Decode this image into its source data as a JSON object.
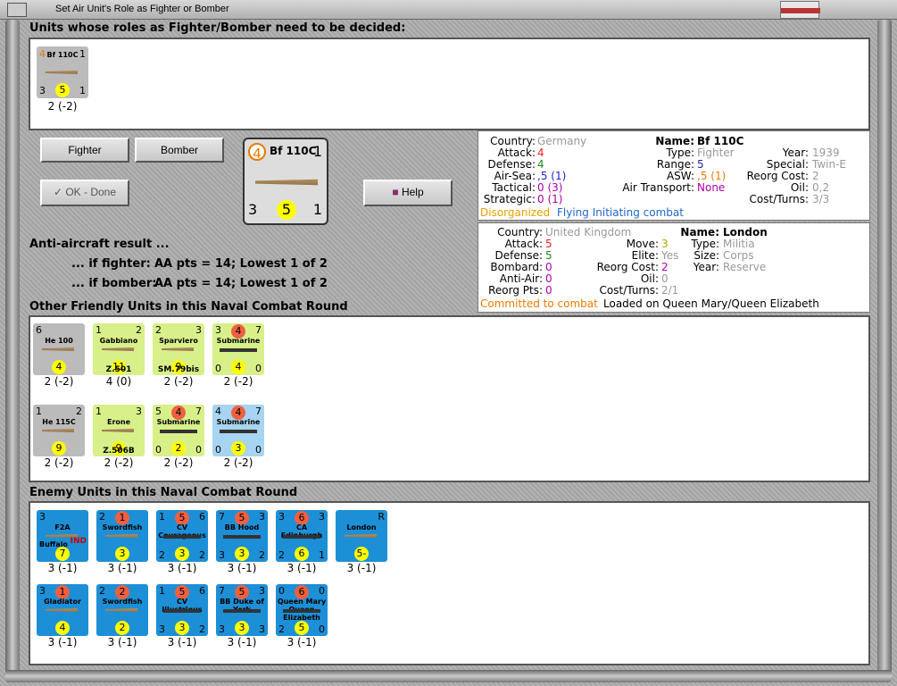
{
  "window": {
    "title": "Set Air Unit's Role as Fighter or Bomber"
  },
  "headers": {
    "undecided": "Units whose roles as Fighter/Bomber need to be decided:",
    "friendly": "Other Friendly Units in this Naval Combat Round",
    "enemy": "Enemy Units in this Naval Combat Round"
  },
  "buttons": {
    "fighter": "Fighter",
    "bomber": "Bomber",
    "ok": "OK - Done",
    "help": "Help"
  },
  "aa": {
    "title": "Anti-aircraft result ...",
    "fighter_lbl": "... if fighter:",
    "fighter_val": "AA pts = 14; Lowest 1 of 2",
    "bomber_lbl": "... if bomber:",
    "bomber_val": "AA pts = 14; Lowest 1 of 2"
  },
  "selected": {
    "name": "Bf 110C",
    "tl": "4",
    "tr": "1",
    "bl": "3",
    "bc": "5",
    "br": "1",
    "caption": "2 (-2)"
  },
  "big": {
    "name": "Bf 110C",
    "tl": "4",
    "tr": "1",
    "bl": "3",
    "bc": "5",
    "br": "1"
  },
  "air_info": {
    "country_k": "Country:",
    "country": "Germany",
    "attack_k": "Attack:",
    "attack": "4",
    "defense_k": "Defense:",
    "defense": "4",
    "airsea_k": "Air-Sea:",
    "airsea": ",5 (1)",
    "tactical_k": "Tactical:",
    "tactical": "0 (3)",
    "strategic_k": "Strategic:",
    "strategic": "0 (1)",
    "name_k": "Name:",
    "name": "Bf 110C",
    "type_k": "Type:",
    "type": "Fighter",
    "range_k": "Range:",
    "range": "5",
    "asw_k": "ASW:",
    "asw": ",5 (1)",
    "airtr_k": "Air Transport:",
    "airtr": "None",
    "year_k": "Year:",
    "year": "1939",
    "special_k": "Special:",
    "special": "Twin-E",
    "reorg_k": "Reorg Cost:",
    "reorg": "2",
    "oil_k": "Oil:",
    "oil": "0,2",
    "cost_k": "Cost/Turns:",
    "cost": "3/3",
    "status1": "Disorganized",
    "status2": "Flying Initiating combat"
  },
  "land_info": {
    "country_k": "Country:",
    "country": "United Kingdom",
    "attack_k": "Attack:",
    "attack": "5",
    "defense_k": "Defense:",
    "defense": "5",
    "bombard_k": "Bombard:",
    "bombard": "0",
    "antiair_k": "Anti-Air:",
    "antiair": "0",
    "reorgpts_k": "Reorg Pts:",
    "reorgpts": "0",
    "move_k": "Move:",
    "move": "3",
    "elite_k": "Elite:",
    "elite": "Yes",
    "reorg_k": "Reorg Cost:",
    "reorg": "2",
    "oil_k": "Oil:",
    "oil": "0",
    "cost_k": "Cost/Turns:",
    "cost": "2/1",
    "name_k": "Name:",
    "name": "London",
    "type_k": "Type:",
    "type": "Militia",
    "size_k": "Size:",
    "size": "Corps",
    "year_k": "Year:",
    "year": "Reserve",
    "status1": "Committed to combat",
    "status2": "Loaded on Queen Mary/Queen Elizabeth"
  },
  "friendly": [
    {
      "name": "He 100",
      "tl": "6",
      "bc": "4",
      "cap": "2 (-2)",
      "kind": "grey"
    },
    {
      "name": "Gabbiano",
      "tl": "1",
      "tr": "2",
      "bc": "11",
      "bn": "Z.501",
      "cap": "4 (0)",
      "kind": "green"
    },
    {
      "name": "Sparviero",
      "tl": "2",
      "tr": "3",
      "bc": "9",
      "bn": "SM.79bis",
      "cap": "2 (-2)",
      "kind": "green"
    },
    {
      "name": "Submarine",
      "tl": "3",
      "tm": "4",
      "tr": "7",
      "bl": "0",
      "bc": "4",
      "br": "0",
      "cap": "2 (-2)",
      "kind": "green"
    },
    {
      "name": "He 115C",
      "tl": "1",
      "tr": "2",
      "bc": "9",
      "cap": "2 (-2)",
      "kind": "grey"
    },
    {
      "name": "Erone",
      "tl": "1",
      "tr": "3",
      "bc": "9",
      "bn": "Z.506B",
      "cap": "2 (-2)",
      "kind": "green"
    },
    {
      "name": "Submarine",
      "tl": "5",
      "tm": "4",
      "tr": "7",
      "bl": "0",
      "bc": "2",
      "br": "0",
      "cap": "2 (-2)",
      "kind": "green"
    },
    {
      "name": "Submarine",
      "tl": "4",
      "tm": "4",
      "tr": "7",
      "bl": "0",
      "bc": "3",
      "br": "0",
      "cap": "2 (-2)",
      "kind": "lblue"
    }
  ],
  "enemy": [
    {
      "name": "F2A",
      "sub": "Buffalo",
      "tl": "3",
      "bc": "7",
      "tag": "IND",
      "cap": "3 (-1)"
    },
    {
      "name": "Swordfish",
      "tl": "2",
      "tm": "1",
      "bc": "3",
      "cap": "3 (-1)"
    },
    {
      "name": "CV Courageous",
      "tl": "1",
      "tm": "5",
      "tr": "6",
      "bl": "2",
      "bc": "3",
      "br": "2",
      "cap": "3 (-1)"
    },
    {
      "name": "BB Hood",
      "tl": "7",
      "tm": "5",
      "tr": "3",
      "bl": "3",
      "bc": "3",
      "br": "2",
      "cap": "3 (-1)"
    },
    {
      "name": "CA Edinburgh",
      "tl": "3",
      "tm": "6",
      "tr": "3",
      "bl": "2",
      "bc": "6",
      "br": "1",
      "cap": "3 (-1)"
    },
    {
      "name": "London",
      "tr": "R",
      "bc": "5-3",
      "cap": "3 (-1)"
    },
    {
      "name": "Gladiator",
      "tl": "3",
      "tm": "1",
      "bc": "4",
      "cap": "3 (-1)"
    },
    {
      "name": "Swordfish",
      "tl": "2",
      "tm": "2",
      "bc": "2",
      "cap": "3 (-1)"
    },
    {
      "name": "CV Illustrious",
      "tl": "1",
      "tm": "5",
      "tr": "6",
      "bl": "3",
      "bc": "3",
      "br": "2",
      "cap": "3 (-1)"
    },
    {
      "name": "BB Duke of York",
      "tl": "7",
      "tm": "5",
      "tr": "3",
      "bl": "3",
      "bc": "3",
      "br": "3",
      "cap": "3 (-1)"
    },
    {
      "name": "Queen Mary Queen Elizabeth",
      "tl": "0",
      "tm": "6",
      "tr": "0",
      "bl": "2",
      "bc": "5",
      "br": "0",
      "cap": "3 (-1)"
    }
  ]
}
